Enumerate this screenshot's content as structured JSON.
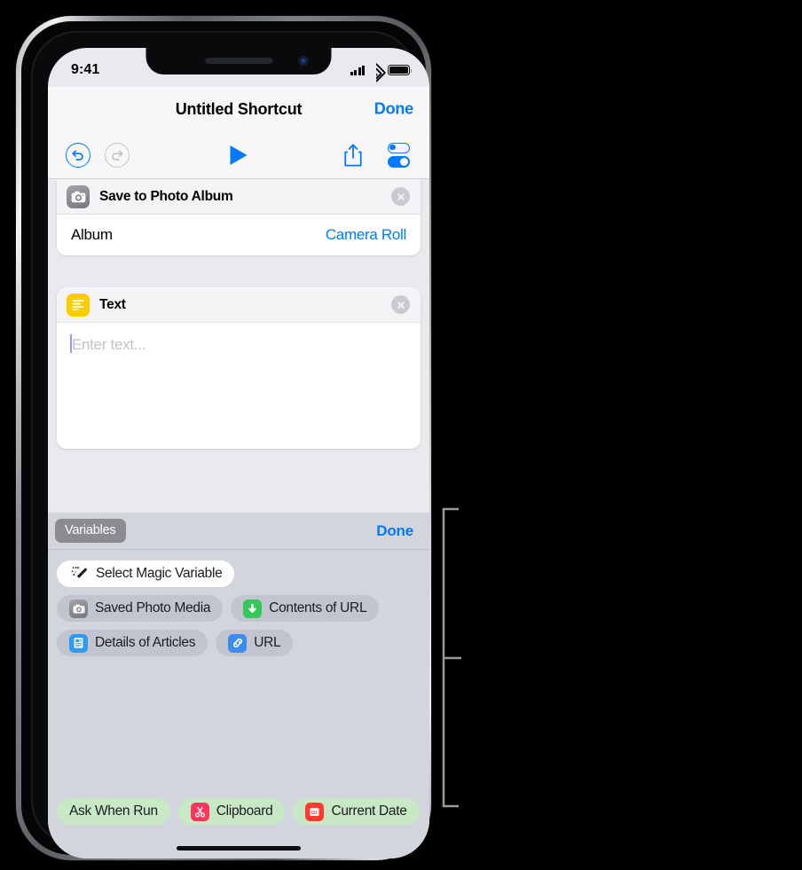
{
  "statusbar": {
    "time": "9:41",
    "signal_icon": "cellular-bars-icon",
    "wifi_icon": "wifi-icon",
    "battery_icon": "battery-full-icon"
  },
  "navbar": {
    "title": "Untitled Shortcut",
    "done_label": "Done"
  },
  "toolbar": {
    "undo_icon": "undo-arrow-icon",
    "redo_icon": "redo-arrow-icon",
    "play_icon": "play-triangle-icon",
    "share_icon": "share-upload-icon",
    "settings_icon": "settings-toggles-icon"
  },
  "actions": [
    {
      "title": "Save to Photo Album",
      "icon": "camera-icon",
      "icon_color": "#8b8b90",
      "close_icon": "close-circle-icon",
      "param_label": "Album",
      "param_value": "Camera Roll"
    },
    {
      "title": "Text",
      "icon": "text-lines-icon",
      "icon_color": "#ffcc00",
      "close_icon": "close-circle-icon",
      "placeholder": "Enter text..."
    }
  ],
  "variables_panel": {
    "tab_label": "Variables",
    "done_label": "Done",
    "magic_variable": {
      "label": "Select Magic Variable",
      "icon": "magic-wand-icon"
    },
    "rows": [
      [
        {
          "label": "Saved Photo Media",
          "icon": "camera-icon",
          "icon_color": "#8b8b90",
          "style": "blue-grey"
        },
        {
          "label": "Contents of URL",
          "icon": "download-arrow-icon",
          "icon_color": "#34c759",
          "style": "blue-grey"
        }
      ],
      [
        {
          "label": "Details of Articles",
          "icon": "article-document-icon",
          "icon_color": "#2e9bf0",
          "style": "blue-grey"
        },
        {
          "label": "URL",
          "icon": "link-chain-icon",
          "icon_color": "#3b8cf0",
          "style": "blue-grey"
        }
      ]
    ],
    "bottom_pills": [
      {
        "label": "Ask When Run",
        "icon": null,
        "icon_color": null,
        "style": "green"
      },
      {
        "label": "Clipboard",
        "icon": "scissors-icon",
        "icon_color": "#ff375f",
        "style": "green"
      },
      {
        "label": "Current Date",
        "icon": "calendar-icon",
        "icon_color": "#ff3b30",
        "style": "green"
      }
    ]
  },
  "colors": {
    "accent_blue": "#007aff",
    "panel_gray": "#d3d5dd",
    "canvas_gray": "#e9e9ee",
    "pill_green": "#c8e8c6"
  },
  "annotation": {
    "bracket_icon": "callout-bracket"
  }
}
